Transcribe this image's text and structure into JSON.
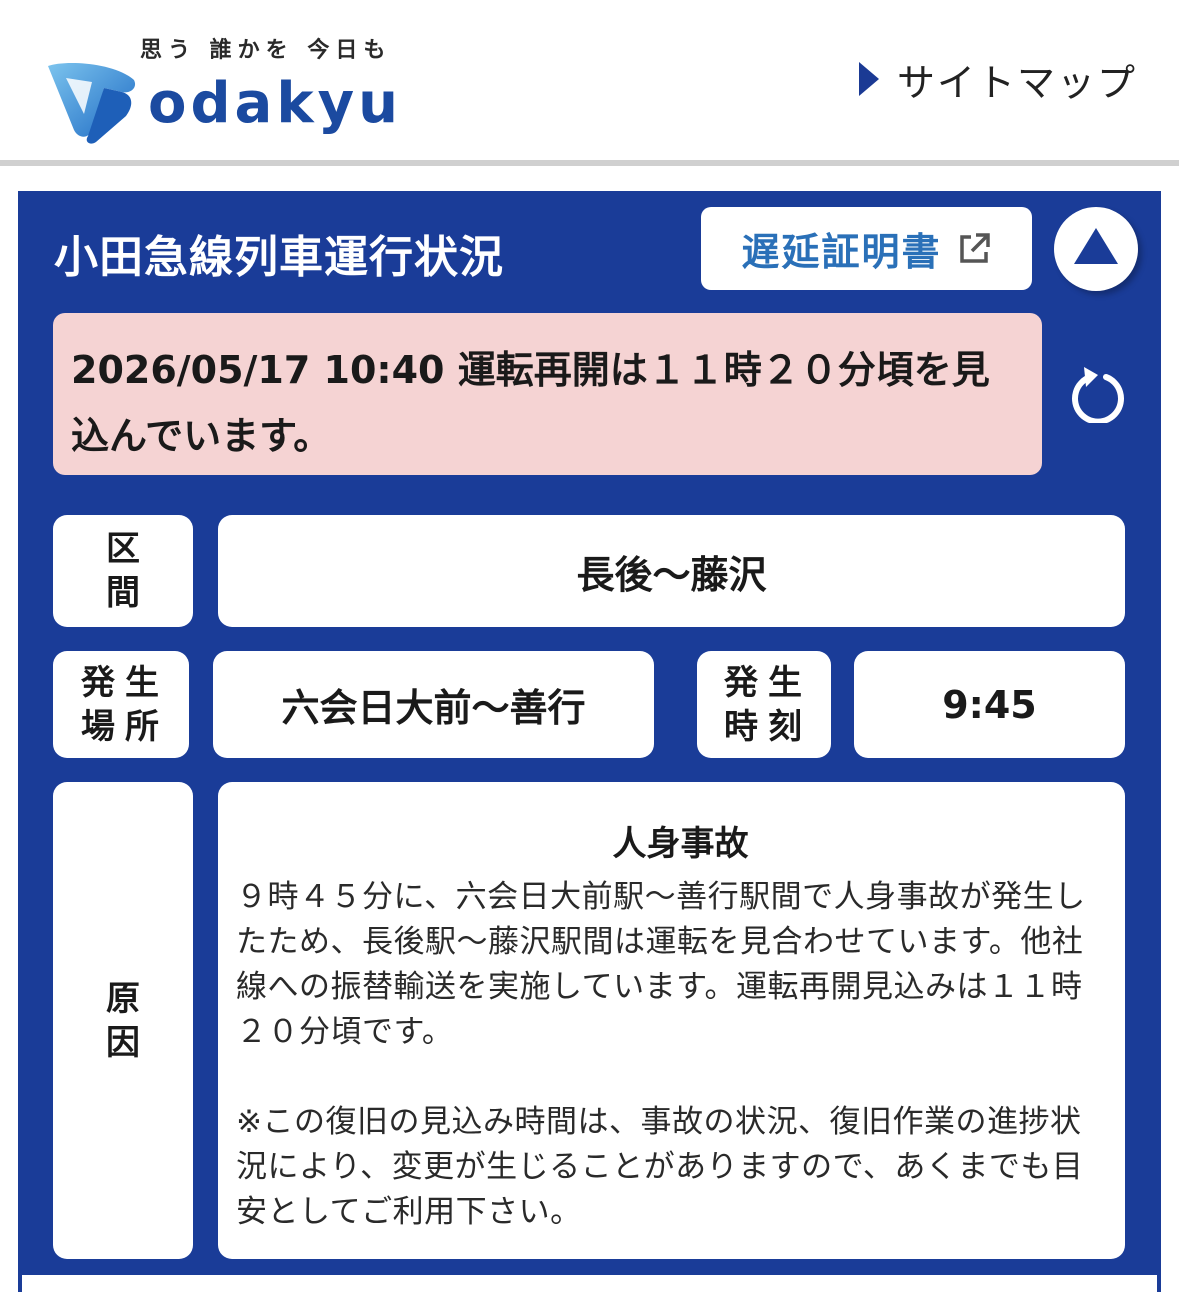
{
  "header": {
    "tagline": "思う 誰かを 今日も",
    "logo_text": "odakyu",
    "sitemap_label": "サイトマップ"
  },
  "panel": {
    "title": "小田急線列車運行状況",
    "certificate_button_label": "遅延証明書",
    "alert_text": "2026/05/17 10:40 運転再開は１１時２０分頃を見込んでいます。",
    "section_label": "区間",
    "section_value": "長後〜藤沢",
    "place_label": "発生場所",
    "place_value": "六会日大前〜善行",
    "time_label": "発生時刻",
    "time_value": "9:45",
    "cause_label": "原因",
    "cause_title": "人身事故",
    "cause_paragraph_1": "９時４５分に、六会日大前駅〜善行駅間で人身事故が発生したため、長後駅〜藤沢駅間は運転を見合わせています。他社線への振替輸送を実施しています。運転再開見込みは１１時２０分頃です。",
    "cause_paragraph_2": "※この復旧の見込み時間は、事故の状況、復旧作業の進捗状況により、変更が生じることがありますので、あくまでも目安としてご利用下さい。"
  },
  "colors": {
    "panel_blue": "#1a3c98",
    "alert_pink": "#f5d3d3",
    "brand_blue": "#1b4aa0",
    "link_blue": "#2a70b8"
  },
  "icons": {
    "external_link": "external-link-icon",
    "scroll_up": "triangle-up-icon",
    "refresh": "refresh-icon",
    "sitemap_arrow": "triangle-right-icon"
  }
}
